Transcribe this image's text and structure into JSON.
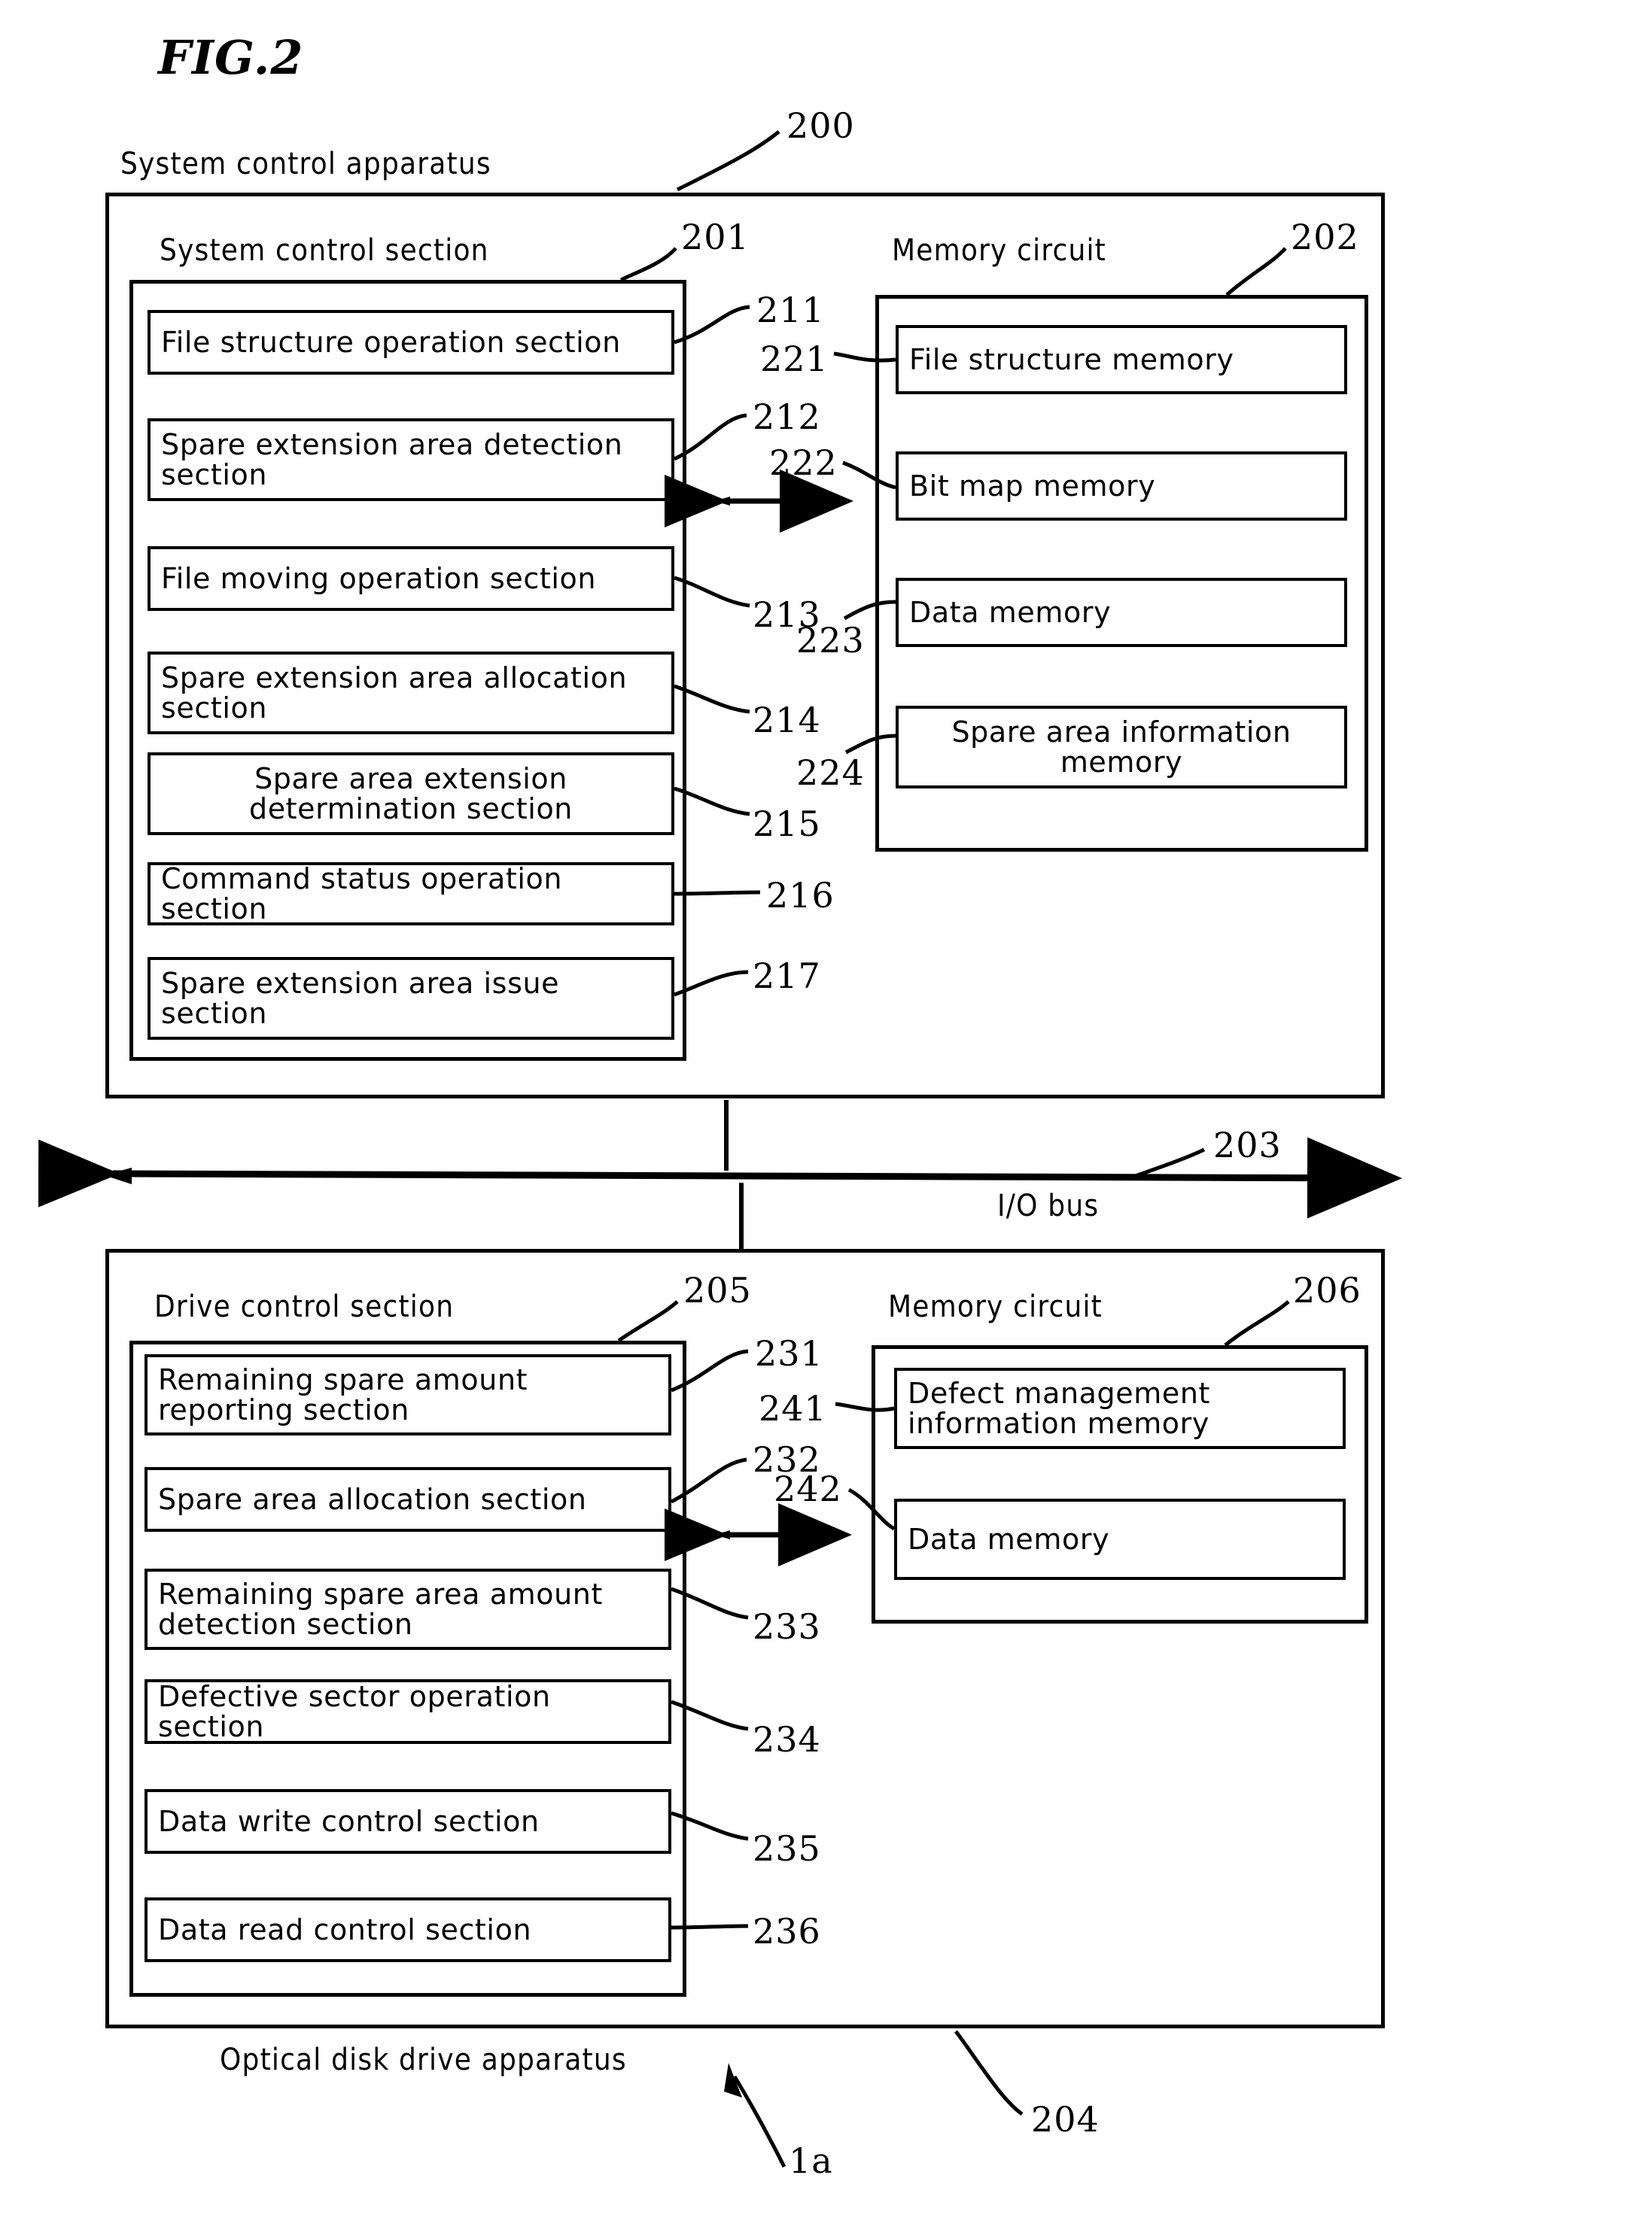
{
  "figure": {
    "title": "FIG.2",
    "bottom_caption": "Optical disk drive apparatus",
    "bottom_ref": "1a"
  },
  "upper": {
    "apparatus_label": "System control apparatus",
    "apparatus_ref": "200",
    "control_section_label": "System control section",
    "control_section_ref": "201",
    "memory_circuit_label": "Memory circuit",
    "memory_circuit_ref": "202",
    "control_units": [
      {
        "label": "File structure operation section",
        "ref": "211",
        "align": "left"
      },
      {
        "label": "Spare extension area detection section",
        "ref": "212",
        "align": "left"
      },
      {
        "label": "File moving operation section",
        "ref": "213",
        "align": "left"
      },
      {
        "label": "Spare extension area allocation section",
        "ref": "214",
        "align": "left"
      },
      {
        "label": "Spare area extension determination section",
        "ref": "215",
        "align": "center"
      },
      {
        "label": "Command status operation section",
        "ref": "216",
        "align": "left"
      },
      {
        "label": "Spare extension area issue section",
        "ref": "217",
        "align": "left"
      }
    ],
    "memory_units": [
      {
        "label": "File structure memory",
        "ref": "221"
      },
      {
        "label": "Bit map memory",
        "ref": "222"
      },
      {
        "label": "Data memory",
        "ref": "223"
      },
      {
        "label": "Spare area information memory",
        "ref": "224"
      }
    ]
  },
  "bus": {
    "label": "I/O bus",
    "ref": "203"
  },
  "lower": {
    "apparatus_ref": "204",
    "control_section_label": "Drive control section",
    "control_section_ref": "205",
    "memory_circuit_label": "Memory circuit",
    "memory_circuit_ref": "206",
    "control_units": [
      {
        "label": "Remaining spare amount reporting section",
        "ref": "231"
      },
      {
        "label": "Spare area allocation section",
        "ref": "232"
      },
      {
        "label": "Remaining spare area amount detection section",
        "ref": "233"
      },
      {
        "label": "Defective sector operation section",
        "ref": "234"
      },
      {
        "label": "Data write control section",
        "ref": "235"
      },
      {
        "label": "Data read control section",
        "ref": "236"
      }
    ],
    "memory_units": [
      {
        "label": "Defect management information memory",
        "ref": "241"
      },
      {
        "label": "Data memory",
        "ref": "242"
      }
    ]
  }
}
